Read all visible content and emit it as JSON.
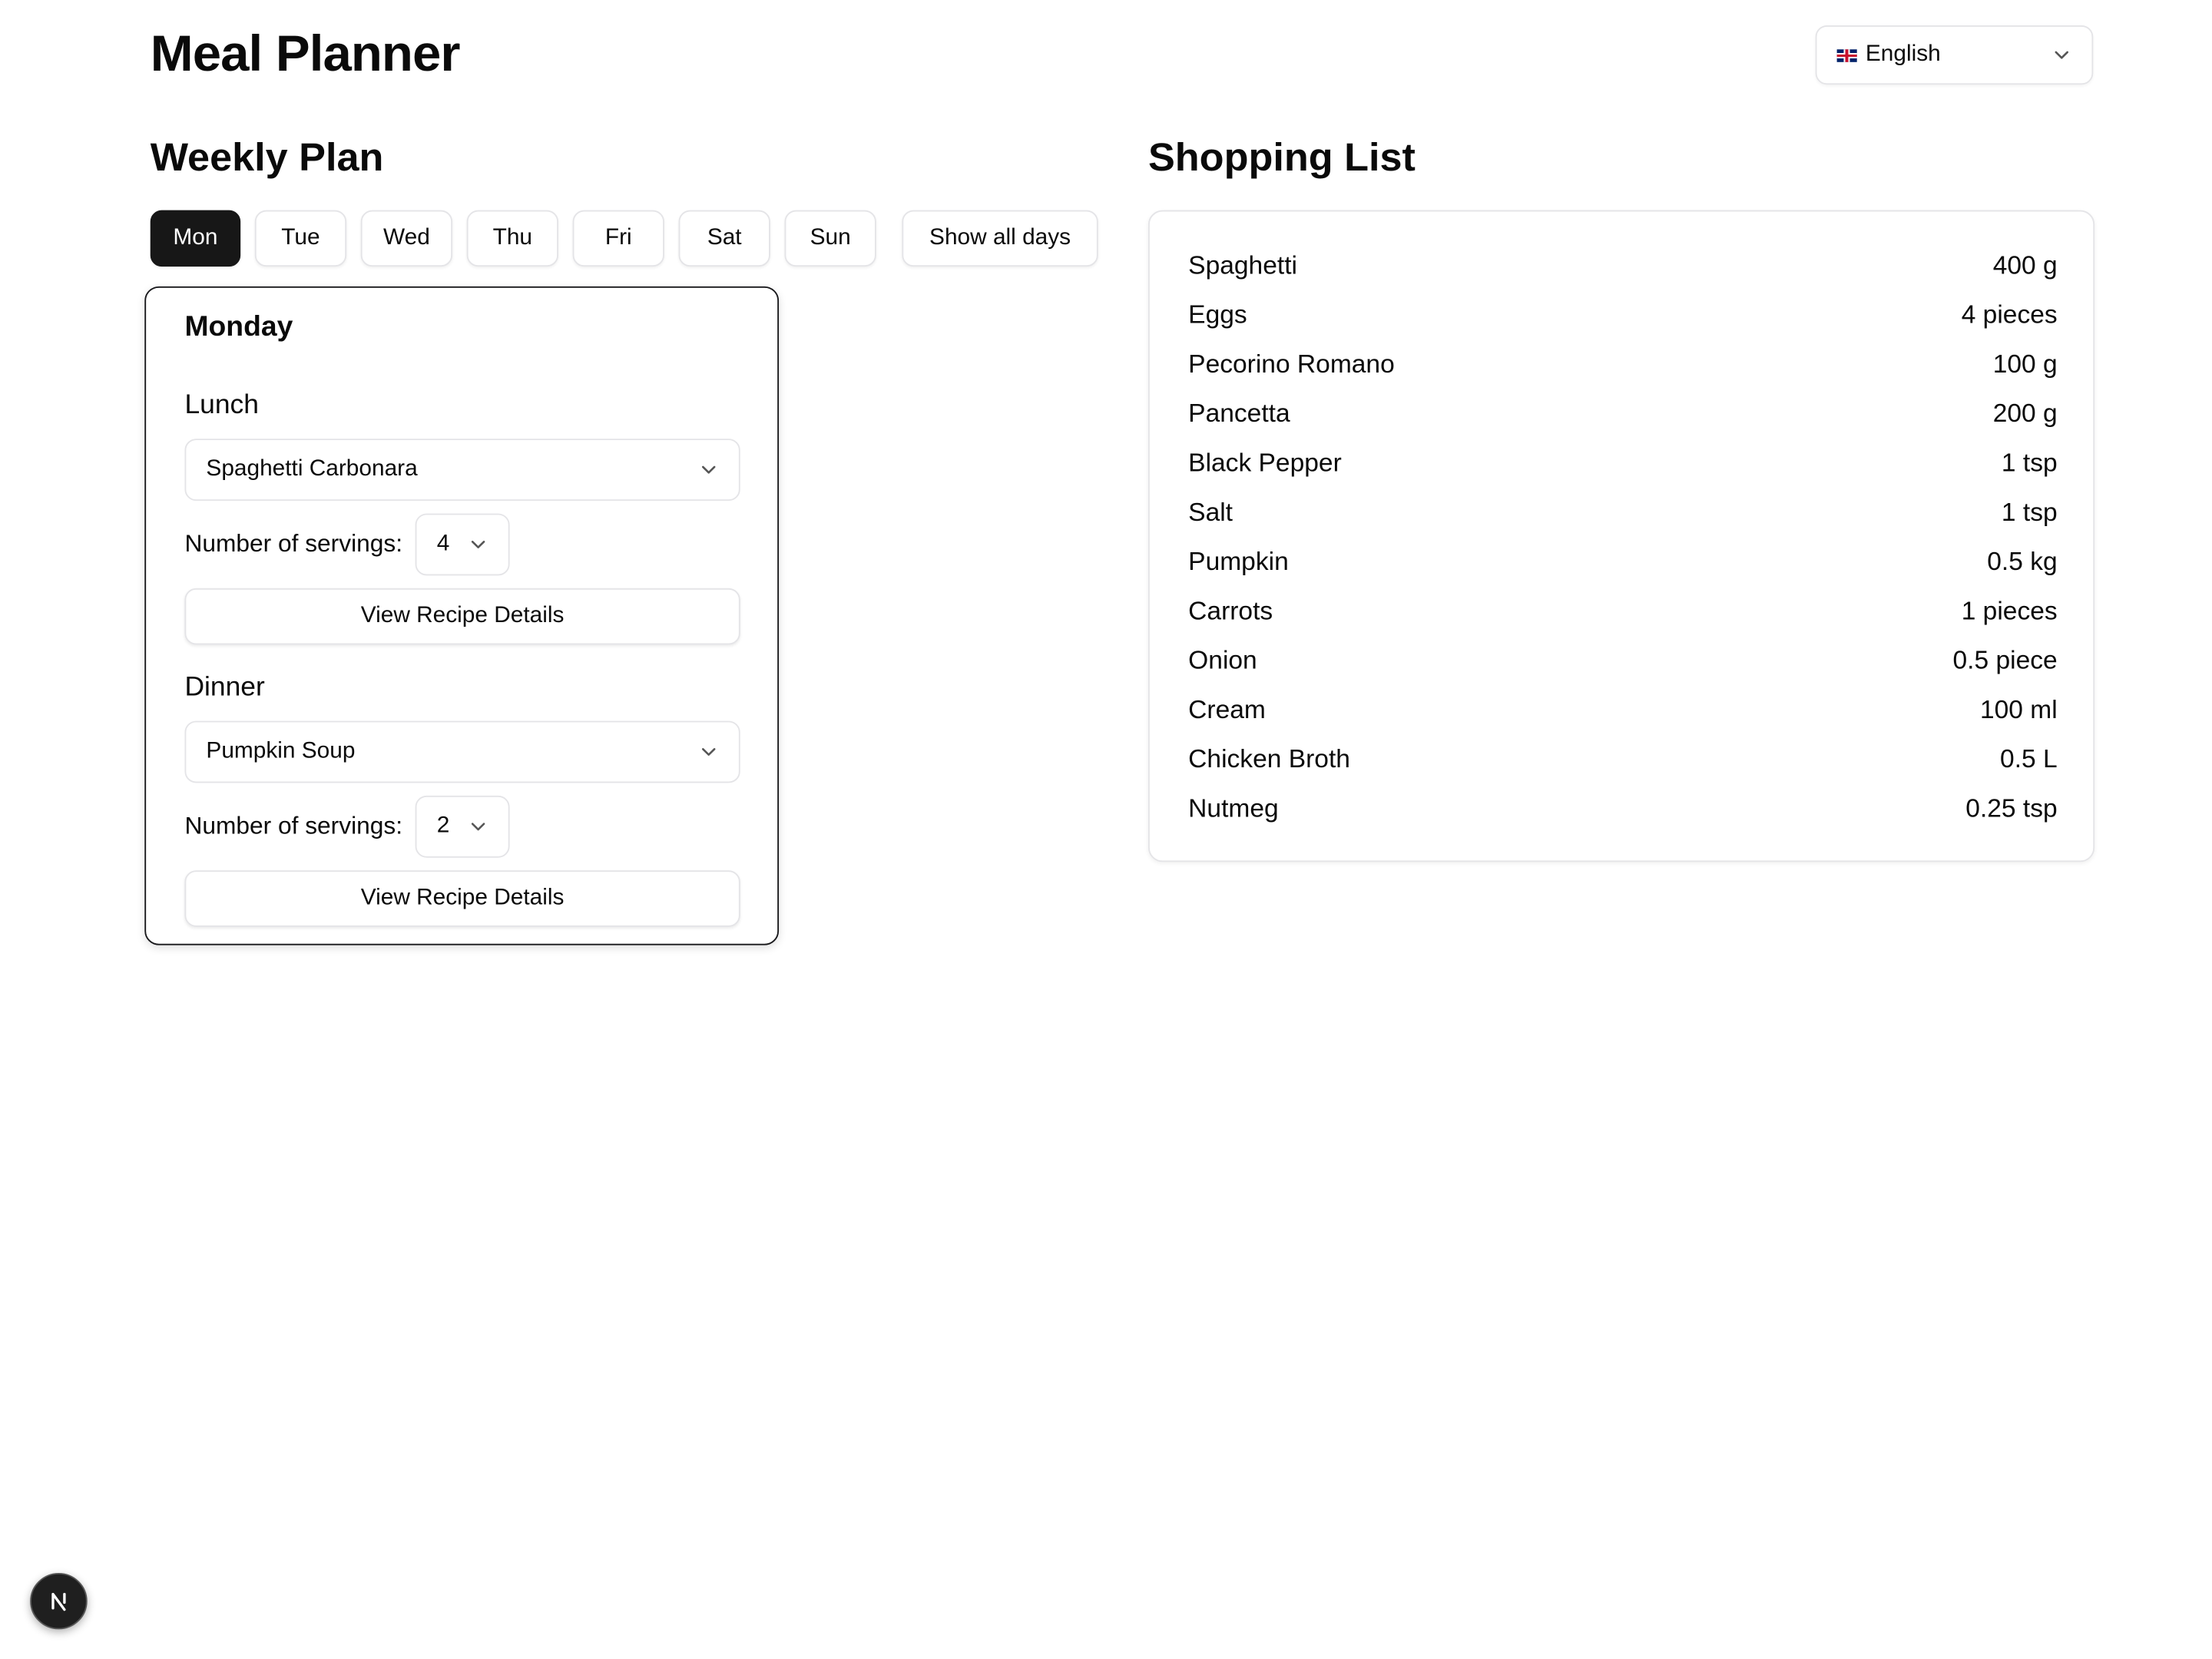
{
  "app": {
    "title": "Meal Planner"
  },
  "language": {
    "selected": "English",
    "flag_icon": "uk-flag-icon"
  },
  "weekly_plan": {
    "title": "Weekly Plan",
    "days": [
      "Mon",
      "Tue",
      "Wed",
      "Thu",
      "Fri",
      "Sat",
      "Sun"
    ],
    "active_day": "Mon",
    "show_all_label": "Show all days",
    "day_card": {
      "title": "Monday",
      "meals": [
        {
          "label": "Lunch",
          "recipe": "Spaghetti Carbonara",
          "servings_label": "Number of servings:",
          "servings": "4",
          "details_label": "View Recipe Details"
        },
        {
          "label": "Dinner",
          "recipe": "Pumpkin Soup",
          "servings_label": "Number of servings:",
          "servings": "2",
          "details_label": "View Recipe Details"
        }
      ]
    }
  },
  "shopping_list": {
    "title": "Shopping List",
    "items": [
      {
        "name": "Spaghetti",
        "qty": "400 g"
      },
      {
        "name": "Eggs",
        "qty": "4 pieces"
      },
      {
        "name": "Pecorino Romano",
        "qty": "100 g"
      },
      {
        "name": "Pancetta",
        "qty": "200 g"
      },
      {
        "name": "Black Pepper",
        "qty": "1 tsp"
      },
      {
        "name": "Salt",
        "qty": "1 tsp"
      },
      {
        "name": "Pumpkin",
        "qty": "0.5 kg"
      },
      {
        "name": "Carrots",
        "qty": "1 pieces"
      },
      {
        "name": "Onion",
        "qty": "0.5 piece"
      },
      {
        "name": "Cream",
        "qty": "100 ml"
      },
      {
        "name": "Chicken Broth",
        "qty": "0.5 L"
      },
      {
        "name": "Nutmeg",
        "qty": "0.25 tsp"
      }
    ]
  },
  "colors": {
    "active_tab": "#171717",
    "border": "#e4e4e7",
    "text": "#0a0a0a"
  }
}
